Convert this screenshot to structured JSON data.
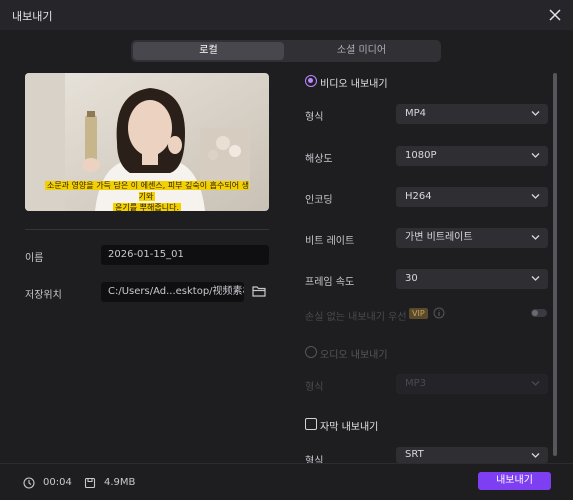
{
  "window": {
    "title": "내보내기"
  },
  "tabs": [
    {
      "label": "로컬",
      "active": true
    },
    {
      "label": "소셜 미디어",
      "active": false
    }
  ],
  "preview": {
    "subtitle_line1": "소문과 영양을 가득 담은 이 에센스, 피부 깊숙이 흡수되어 생기와",
    "subtitle_line2": "윤기를 뿌해줍니다."
  },
  "left_form": {
    "name_label": "이름",
    "name_value": "2026-01-15_01",
    "location_label": "저장위치",
    "location_value": "C:/Users/Ad...esktop/视频素材"
  },
  "video_export": {
    "label": "비디오 내보내기",
    "selected": true,
    "rows": [
      {
        "label": "형식",
        "value": "MP4"
      },
      {
        "label": "해상도",
        "value": "1080P"
      },
      {
        "label": "인코딩",
        "value": "H264"
      },
      {
        "label": "비트 레이트",
        "value": "가변 비트레이트"
      },
      {
        "label": "프레임 속도",
        "value": "30"
      }
    ],
    "lossless_label": "손실 없는 내보내기 우선",
    "vip_badge": "VIP"
  },
  "audio_export": {
    "label": "오디오 내보내기",
    "selected": false,
    "format_label": "형식",
    "format_value": "MP3"
  },
  "subtitle_export": {
    "label": "자막 내보내기",
    "checked": false,
    "format_label": "형식",
    "format_value": "SRT"
  },
  "footer": {
    "duration": "00:04",
    "size": "4.9MB",
    "export_label": "내보내기"
  },
  "colors": {
    "accent": "#7e3ff2",
    "radio": "#b98bff",
    "background": "#1e1e21"
  },
  "icons": [
    "close-icon",
    "chevron-down-icon",
    "folder-icon",
    "info-icon",
    "clock-icon",
    "file-size-icon"
  ]
}
